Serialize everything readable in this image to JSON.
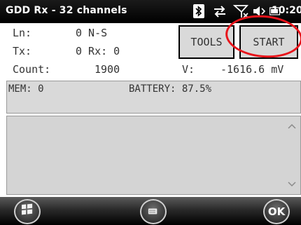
{
  "titlebar": {
    "title": "GDD Rx - 32 channels",
    "clock": "10:20",
    "icons": [
      "bluetooth-icon",
      "sync-icon",
      "signal-off-icon",
      "volume-icon",
      "battery-icon"
    ]
  },
  "info": {
    "ln_label": "Ln:",
    "ln_value": "0 N-S",
    "tx_label": "Tx:",
    "tx_value": "0 Rx: 0",
    "count_label": "Count:",
    "count_value": "1900",
    "v_label": "V:",
    "v_value": "-1616.6 mV"
  },
  "buttons": {
    "tools": "TOOLS",
    "start": "START"
  },
  "status": {
    "mem": "MEM: 0",
    "battery": "BATTERY: 87.5%"
  },
  "softkeys": {
    "ok": "OK"
  },
  "colors": {
    "highlight": "#e8141b",
    "panel": "#d9d9d9",
    "titlebar": "#000000"
  }
}
